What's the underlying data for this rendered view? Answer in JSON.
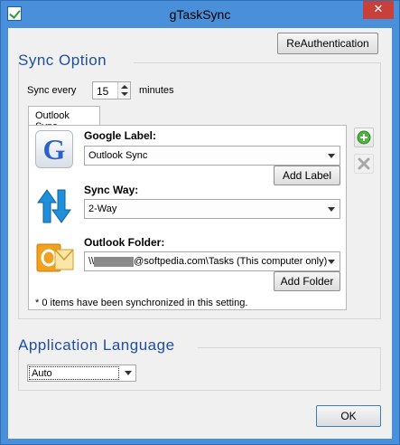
{
  "window": {
    "title": "gTaskSync",
    "close_glyph": "✕"
  },
  "toolbar": {
    "reauth_label": "ReAuthentication"
  },
  "sync_option": {
    "heading": "Sync Option",
    "sync_every_label": "Sync every",
    "sync_every_value": "15",
    "minutes_label": "minutes"
  },
  "tabs": [
    {
      "label": "Outlook Sync",
      "selected": true
    }
  ],
  "google_label": {
    "heading": "Google Label:",
    "value": "Outlook Sync",
    "add_button": "Add Label",
    "icon": "google-g-icon"
  },
  "sync_way": {
    "heading": "Sync Way:",
    "value": "2-Way",
    "icon": "sync-arrows-icon"
  },
  "outlook_folder": {
    "heading": "Outlook Folder:",
    "value_prefix": "\\\\",
    "value_suffix": "@softpedia.com\\Tasks (This computer only)",
    "add_button": "Add Folder",
    "icon": "outlook-icon"
  },
  "status_text": "* 0 items have been synchronized in this setting.",
  "side_buttons": {
    "add_icon": "plus-icon",
    "remove_icon": "x-icon"
  },
  "app_language": {
    "heading": "Application Language",
    "value": "Auto"
  },
  "footer": {
    "ok_label": "OK"
  },
  "colors": {
    "accent": "#1e4fa3",
    "window_frame": "#4a8fd9",
    "close": "#c7403a"
  }
}
